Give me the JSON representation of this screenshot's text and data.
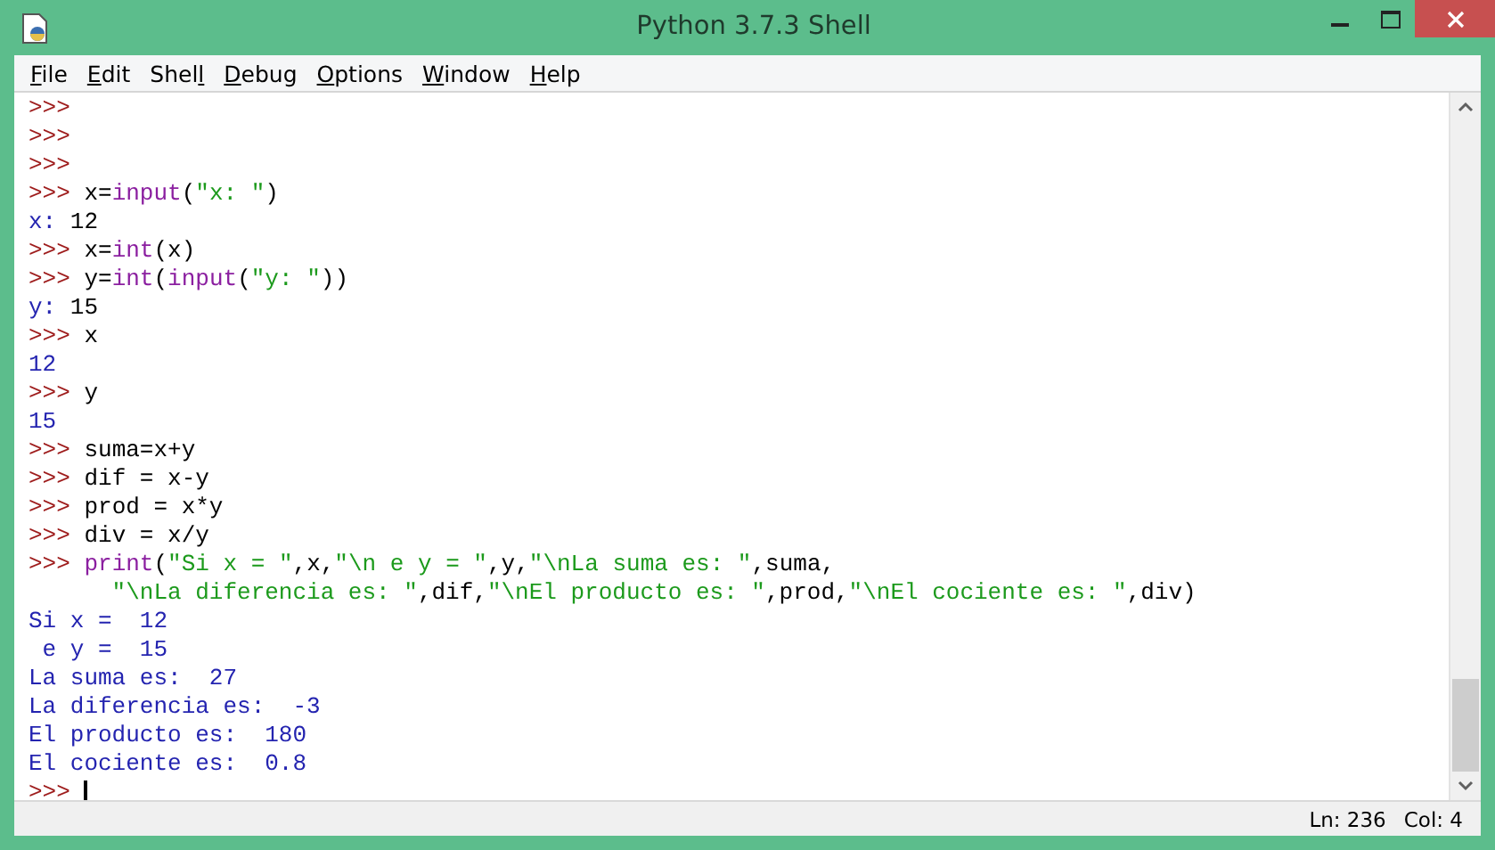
{
  "window": {
    "title": "Python 3.7.3 Shell"
  },
  "menu": [
    {
      "mnemonic": "F",
      "after": "ile"
    },
    {
      "mnemonic": "E",
      "after": "dit"
    },
    {
      "before": "Shel",
      "mnemonic": "l"
    },
    {
      "mnemonic": "D",
      "after": "ebug"
    },
    {
      "mnemonic": "O",
      "after": "ptions"
    },
    {
      "mnemonic": "W",
      "after": "indow"
    },
    {
      "mnemonic": "H",
      "after": "elp"
    }
  ],
  "lines": [
    [
      {
        "kind": "prompt",
        "text": ">>>"
      }
    ],
    [
      {
        "kind": "prompt",
        "text": ">>>"
      }
    ],
    [
      {
        "kind": "prompt",
        "text": ">>>"
      }
    ],
    [
      {
        "kind": "prompt",
        "text": ">>> "
      },
      {
        "kind": "code",
        "text": "x="
      },
      {
        "kind": "builtin",
        "text": "input"
      },
      {
        "kind": "code",
        "text": "("
      },
      {
        "kind": "string",
        "text": "\"x: \""
      },
      {
        "kind": "code",
        "text": ")"
      }
    ],
    [
      {
        "kind": "output",
        "text": "x: "
      },
      {
        "kind": "code",
        "text": "12"
      }
    ],
    [
      {
        "kind": "prompt",
        "text": ">>> "
      },
      {
        "kind": "code",
        "text": "x="
      },
      {
        "kind": "builtin",
        "text": "int"
      },
      {
        "kind": "code",
        "text": "(x)"
      }
    ],
    [
      {
        "kind": "prompt",
        "text": ">>> "
      },
      {
        "kind": "code",
        "text": "y="
      },
      {
        "kind": "builtin",
        "text": "int"
      },
      {
        "kind": "code",
        "text": "("
      },
      {
        "kind": "builtin",
        "text": "input"
      },
      {
        "kind": "code",
        "text": "("
      },
      {
        "kind": "string",
        "text": "\"y: \""
      },
      {
        "kind": "code",
        "text": "))"
      }
    ],
    [
      {
        "kind": "output",
        "text": "y: "
      },
      {
        "kind": "code",
        "text": "15"
      }
    ],
    [
      {
        "kind": "prompt",
        "text": ">>> "
      },
      {
        "kind": "code",
        "text": "x"
      }
    ],
    [
      {
        "kind": "output",
        "text": "12"
      }
    ],
    [
      {
        "kind": "prompt",
        "text": ">>> "
      },
      {
        "kind": "code",
        "text": "y"
      }
    ],
    [
      {
        "kind": "output",
        "text": "15"
      }
    ],
    [
      {
        "kind": "prompt",
        "text": ">>> "
      },
      {
        "kind": "code",
        "text": "suma=x+y"
      }
    ],
    [
      {
        "kind": "prompt",
        "text": ">>> "
      },
      {
        "kind": "code",
        "text": "dif = x-y"
      }
    ],
    [
      {
        "kind": "prompt",
        "text": ">>> "
      },
      {
        "kind": "code",
        "text": "prod = x*y"
      }
    ],
    [
      {
        "kind": "prompt",
        "text": ">>> "
      },
      {
        "kind": "code",
        "text": "div = x/y"
      }
    ],
    [
      {
        "kind": "prompt",
        "text": ">>> "
      },
      {
        "kind": "builtin",
        "text": "print"
      },
      {
        "kind": "code",
        "text": "("
      },
      {
        "kind": "string",
        "text": "\"Si x = \""
      },
      {
        "kind": "code",
        "text": ",x,"
      },
      {
        "kind": "string",
        "text": "\"\\n e y = \""
      },
      {
        "kind": "code",
        "text": ",y,"
      },
      {
        "kind": "string",
        "text": "\"\\nLa suma es: \""
      },
      {
        "kind": "code",
        "text": ",suma,"
      }
    ],
    [
      {
        "kind": "string",
        "text": "      \"\\nLa diferencia es: \""
      },
      {
        "kind": "code",
        "text": ",dif,"
      },
      {
        "kind": "string",
        "text": "\"\\nEl producto es: \""
      },
      {
        "kind": "code",
        "text": ",prod,"
      },
      {
        "kind": "string",
        "text": "\"\\nEl cociente es: \""
      },
      {
        "kind": "code",
        "text": ",div)"
      }
    ],
    [
      {
        "kind": "output",
        "text": "Si x =  12"
      }
    ],
    [
      {
        "kind": "output",
        "text": " e y =  15"
      }
    ],
    [
      {
        "kind": "output",
        "text": "La suma es:  27"
      }
    ],
    [
      {
        "kind": "output",
        "text": "La diferencia es:  -3"
      }
    ],
    [
      {
        "kind": "output",
        "text": "El producto es:  180"
      }
    ],
    [
      {
        "kind": "output",
        "text": "El cociente es:  0.8"
      }
    ],
    [
      {
        "kind": "prompt",
        "text": ">>> "
      },
      {
        "kind": "cursor"
      }
    ]
  ],
  "status_bar": {
    "line": "Ln: 236",
    "column": "Col: 4"
  }
}
